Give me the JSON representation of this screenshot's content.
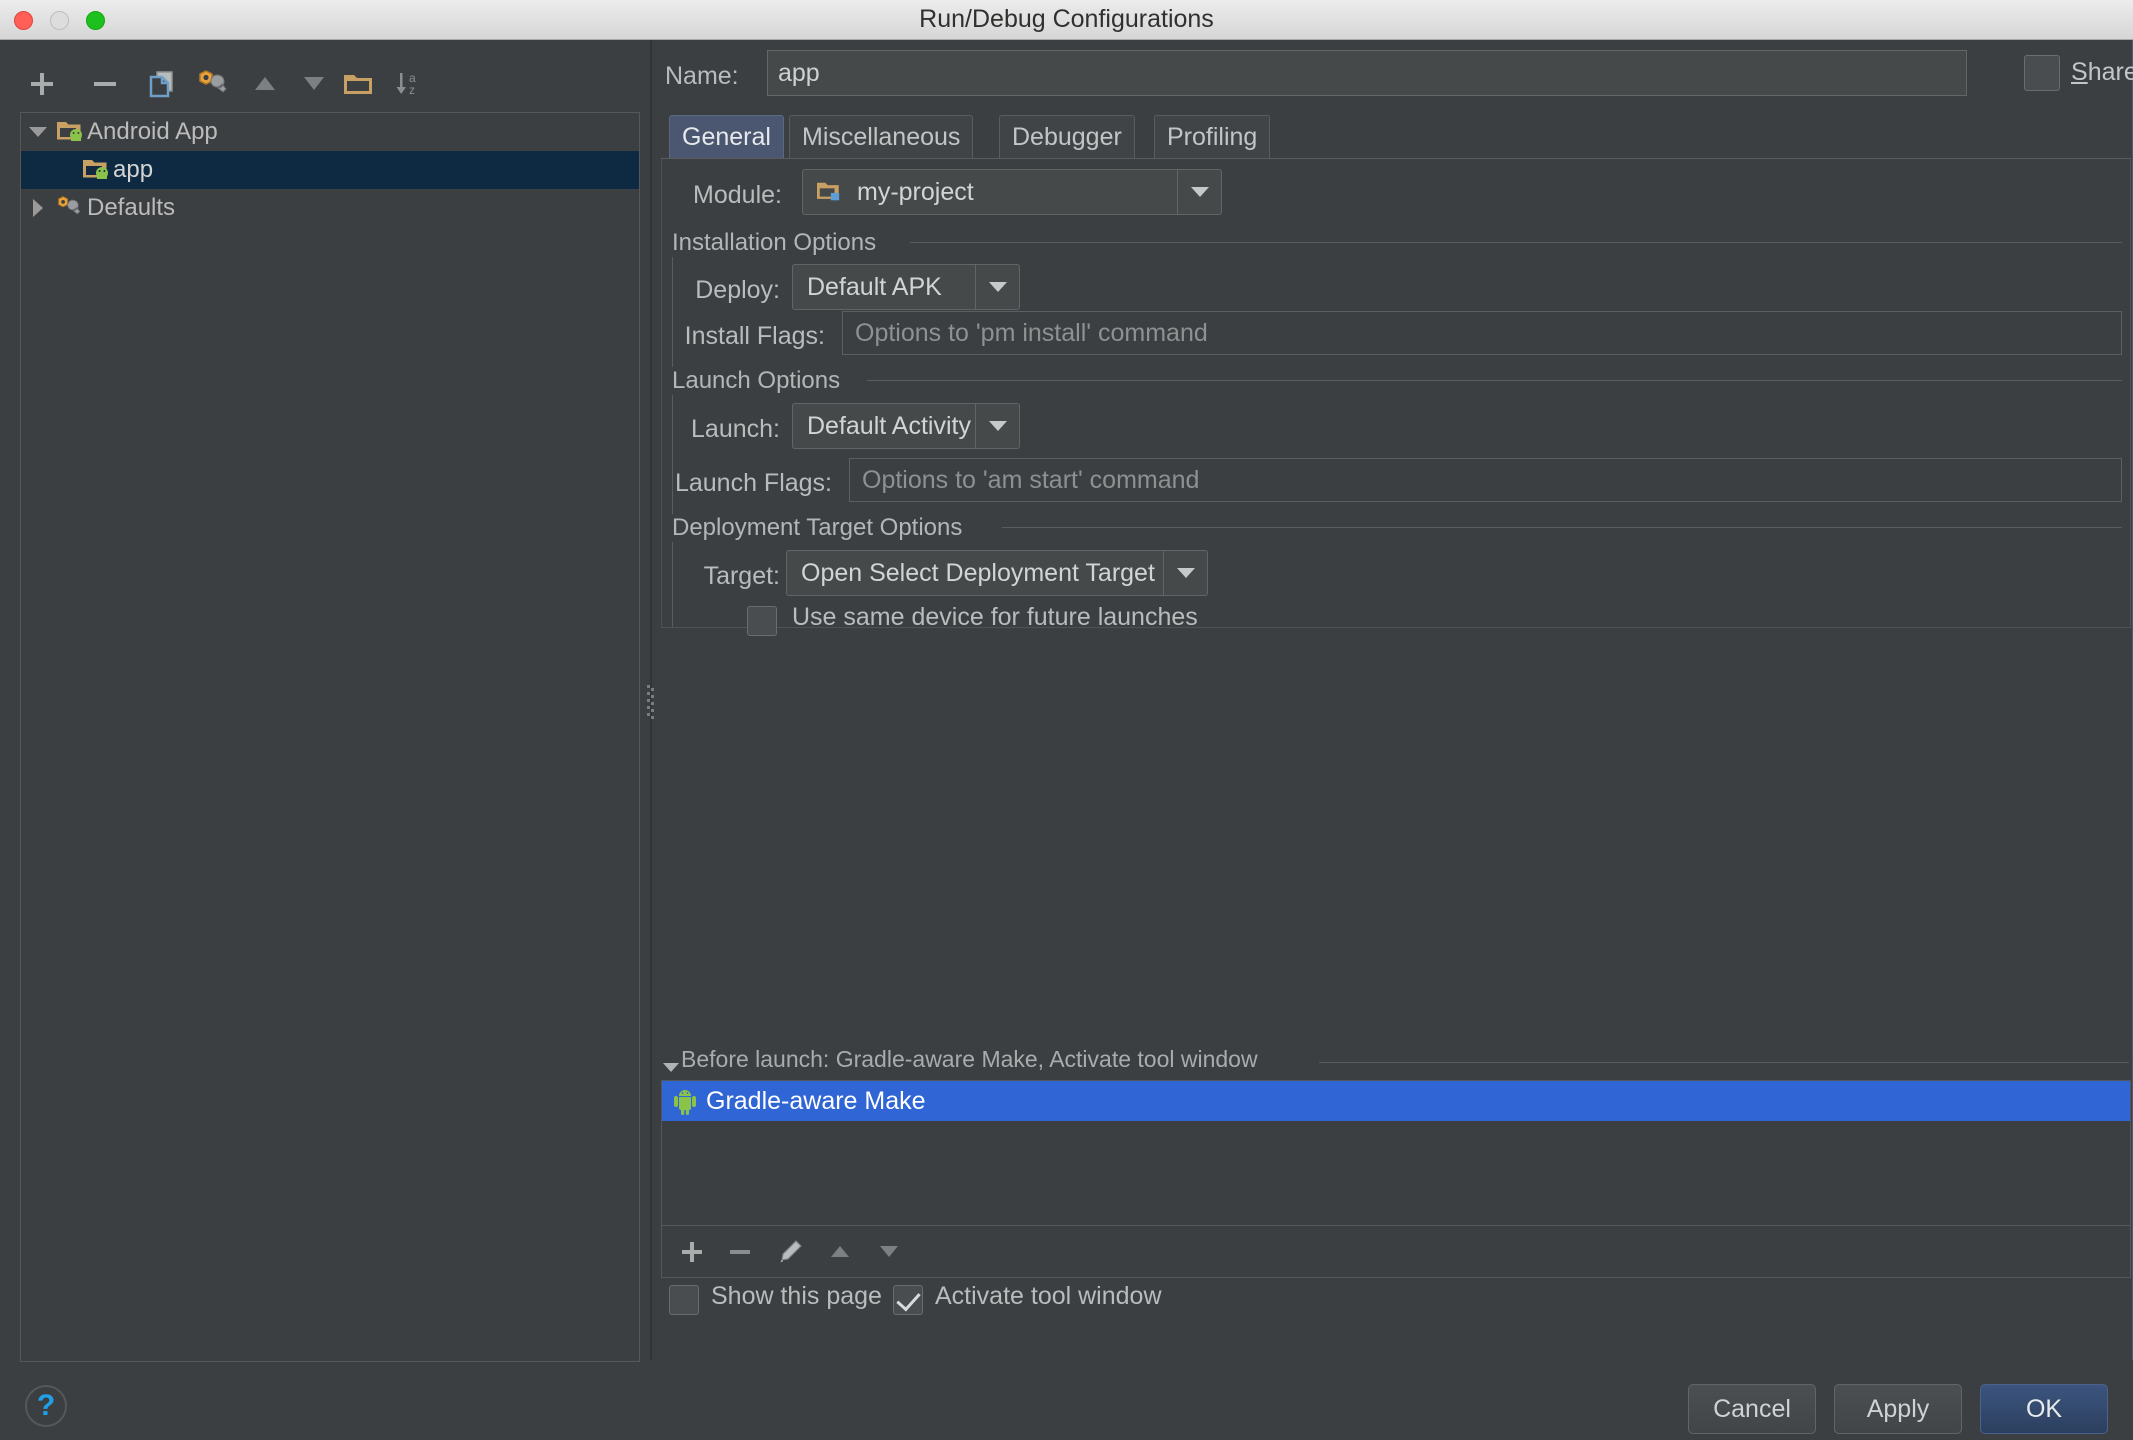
{
  "window": {
    "title": "Run/Debug Configurations",
    "traffic_lights": [
      "close",
      "minimize",
      "maximize"
    ]
  },
  "sidebar": {
    "toolbar": [
      {
        "name": "add",
        "icon": "plus-icon"
      },
      {
        "name": "remove",
        "icon": "minus-icon"
      },
      {
        "name": "copy",
        "icon": "copy-configuration-icon"
      },
      {
        "name": "edit-defaults",
        "icon": "wrench-icon"
      },
      {
        "name": "move-up",
        "icon": "arrow-up-icon"
      },
      {
        "name": "move-down",
        "icon": "arrow-down-icon"
      },
      {
        "name": "new-folder",
        "icon": "folder-icon"
      },
      {
        "name": "sort",
        "icon": "sort-alphabetical-icon"
      }
    ],
    "tree": [
      {
        "label": "Android App",
        "expanded": true,
        "level": 0,
        "icon": "android-module-icon",
        "selected": false
      },
      {
        "label": "app",
        "expanded": null,
        "level": 1,
        "icon": "android-module-icon",
        "selected": true
      },
      {
        "label": "Defaults",
        "expanded": false,
        "level": 0,
        "icon": "wrench-icon",
        "selected": false
      }
    ]
  },
  "header": {
    "name_label": "Name:",
    "name_value": "app",
    "share_label": "Share",
    "share_mnemonic": "S",
    "share_checked": false
  },
  "tabs": [
    {
      "label": "General",
      "active": true
    },
    {
      "label": "Miscellaneous",
      "active": false
    },
    {
      "label": "Debugger",
      "active": false
    },
    {
      "label": "Profiling",
      "active": false
    }
  ],
  "general": {
    "module": {
      "label": "Module:",
      "value": "my-project",
      "icon": "module-folder-icon"
    },
    "installation_options": {
      "title": "Installation Options",
      "deploy": {
        "label": "Deploy:",
        "value": "Default APK"
      },
      "install_flags": {
        "label": "Install Flags:",
        "value": "",
        "placeholder": "Options to 'pm install' command"
      }
    },
    "launch_options": {
      "title": "Launch Options",
      "launch": {
        "label": "Launch:",
        "value": "Default Activity"
      },
      "launch_flags": {
        "label": "Launch Flags:",
        "value": "",
        "placeholder": "Options to 'am start' command"
      }
    },
    "deployment_target_options": {
      "title": "Deployment Target Options",
      "target": {
        "label": "Target:",
        "value": "Open Select Deployment Target Dialog"
      },
      "use_same_device": {
        "label": "Use same device for future launches",
        "checked": false
      }
    }
  },
  "before_launch": {
    "title": "Before launch: Gradle-aware Make, Activate tool window",
    "expanded": true,
    "items": [
      {
        "label": "Gradle-aware Make",
        "icon": "android-icon",
        "selected": true
      }
    ],
    "toolbar": [
      {
        "name": "add",
        "icon": "plus-icon"
      },
      {
        "name": "remove",
        "icon": "minus-icon"
      },
      {
        "name": "edit",
        "icon": "pencil-icon"
      },
      {
        "name": "move-up",
        "icon": "arrow-up-icon"
      },
      {
        "name": "move-down",
        "icon": "arrow-down-icon"
      }
    ],
    "show_this_page": {
      "label": "Show this page",
      "checked": false
    },
    "activate_tool_window": {
      "label": "Activate tool window",
      "checked": true
    }
  },
  "footer": {
    "help_icon": "question-mark-icon",
    "cancel_label": "Cancel",
    "apply_label": "Apply",
    "ok_label": "OK"
  },
  "colors": {
    "background": "#3c3f41",
    "selection_blue": "#2f65d4",
    "tree_selection": "#0d2a42",
    "active_tab": "#4b5670",
    "primary_button": "#3c557f",
    "help_blue": "#20a0e8",
    "android_green": "#8bc34a",
    "folder_orange": "#c9a063"
  }
}
